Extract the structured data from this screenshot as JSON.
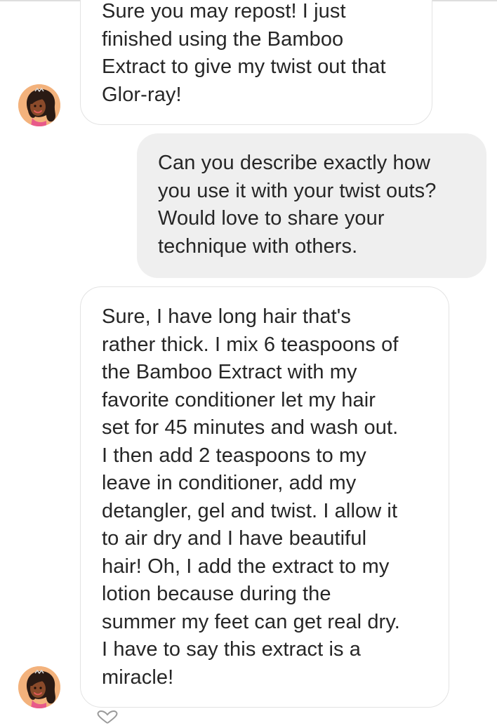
{
  "messages": [
    {
      "sender": "other",
      "lines": [
        "Sure you may repost! I just",
        "finished using the Bamboo",
        "Extract to give my twist out that",
        "Glor-ray!"
      ]
    },
    {
      "sender": "me",
      "lines": [
        "Can you describe exactly how",
        "you use it with your twist outs?",
        "Would love to share your",
        "technique with others."
      ]
    },
    {
      "sender": "other",
      "lines": [
        "Sure, I have long hair that's",
        "rather thick.  I mix 6 teaspoons of",
        "the Bamboo Extract with my",
        "favorite conditioner let my hair",
        "set for 45 minutes and wash out.",
        "I then add 2 teaspoons to my",
        "leave in conditioner, add my",
        "detangler, gel and twist. I allow it",
        "to air dry and I have beautiful",
        "hair! Oh, I add the extract to my",
        "lotion because during the",
        "summer my feet can get real dry.",
        "I have to say this extract is a",
        "miracle!"
      ]
    }
  ],
  "icons": {
    "avatar": "cartoon-woman-avatar-icon",
    "like": "heart-icon"
  },
  "colors": {
    "incoming_bubble_border": "#e3e3e3",
    "outgoing_bubble_bg": "#efefef",
    "text": "#262626"
  }
}
